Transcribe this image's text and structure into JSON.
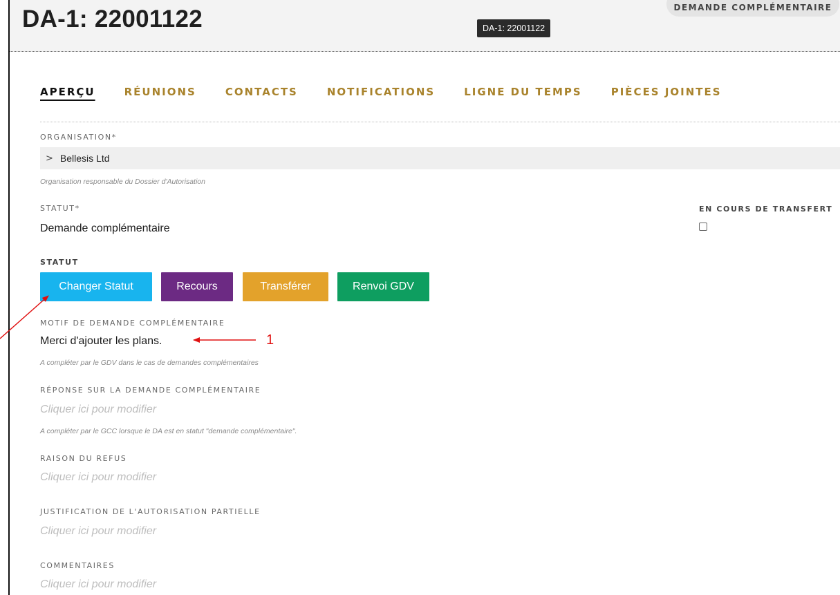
{
  "header": {
    "title": "DA-1: 22001122",
    "status_pill": "DEMANDE COMPLÉMENTAIRE",
    "tooltip": "DA-1: 22001122"
  },
  "tabs": [
    {
      "label": "APERÇU",
      "active": true
    },
    {
      "label": "RÉUNIONS",
      "active": false
    },
    {
      "label": "CONTACTS",
      "active": false
    },
    {
      "label": "NOTIFICATIONS",
      "active": false
    },
    {
      "label": "LIGNE DU TEMPS",
      "active": false
    },
    {
      "label": "PIÈCES JOINTES",
      "active": false
    }
  ],
  "organisation": {
    "label": "ORGANISATION*",
    "value": "Bellesis Ltd",
    "help": "Organisation responsable du Dossier d'Autorisation",
    "chevron_icon": "chevron-right-icon"
  },
  "statut": {
    "label": "STATUT*",
    "value": "Demande complémentaire"
  },
  "transfert": {
    "label": "EN COURS DE TRANSFERT",
    "checked": false
  },
  "actions": {
    "label": "STATUT",
    "buttons": [
      {
        "label": "Changer Statut",
        "color": "#18b4ee"
      },
      {
        "label": "Recours",
        "color": "#6c2a83"
      },
      {
        "label": "Transférer",
        "color": "#e3a22b"
      },
      {
        "label": "Renvoi GDV",
        "color": "#0e9e60"
      }
    ]
  },
  "motif": {
    "label": "MOTIF DE DEMANDE COMPLÉMENTAIRE",
    "value": "Merci d'ajouter les plans.",
    "help": "A compléter par le GDV dans le cas de demandes complémentaires"
  },
  "reponse": {
    "label": "RÉPONSE SUR LA DEMANDE COMPLÉMENTAIRE",
    "placeholder": "Cliquer ici pour modifier",
    "help": "A compléter par le GCC lorsque le DA est en statut \"demande complémentaire\"."
  },
  "refus": {
    "label": "RAISON DU REFUS",
    "placeholder": "Cliquer ici pour modifier"
  },
  "justification": {
    "label": "JUSTIFICATION DE L'AUTORISATION PARTIELLE",
    "placeholder": "Cliquer ici pour modifier"
  },
  "commentaires": {
    "label": "COMMENTAIRES",
    "placeholder": "Cliquer ici pour modifier"
  },
  "annotations": {
    "number_1": "1",
    "arrow_color": "#e01010"
  }
}
